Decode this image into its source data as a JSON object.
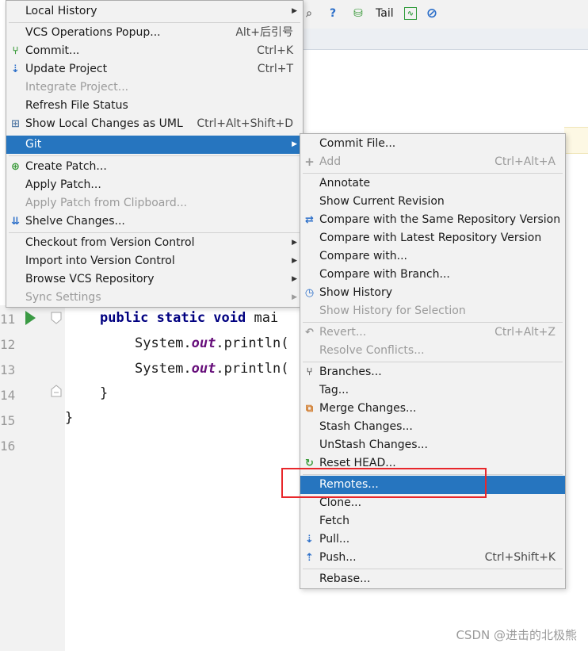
{
  "toolbar": {
    "help_icon": "question-icon",
    "tail_label": "Tail"
  },
  "editor": {
    "line_numbers": [
      "11",
      "12",
      "13",
      "14",
      "15",
      "16"
    ],
    "lines": {
      "l11_kw": "public static void ",
      "l11_name": "mai",
      "l12_obj": "System.",
      "l12_field": "out",
      "l12_call": ".println(",
      "l13_obj": "System.",
      "l13_field": "out",
      "l13_call": ".println(",
      "l14": "}",
      "l15": "}"
    }
  },
  "vcs_menu": {
    "items": [
      {
        "label": "Local History",
        "submenu": true
      },
      {
        "label": "VCS Operations Popup...",
        "shortcut": "Alt+后引号"
      },
      {
        "label": "Commit...",
        "shortcut": "Ctrl+K",
        "icon": "commit-icon"
      },
      {
        "label": "Update Project",
        "shortcut": "Ctrl+T",
        "icon": "update-project-icon"
      },
      {
        "label": "Integrate Project...",
        "disabled": true
      },
      {
        "label": "Refresh File Status"
      },
      {
        "label": "Show Local Changes as UML",
        "shortcut": "Ctrl+Alt+Shift+D",
        "icon": "uml-icon"
      },
      {
        "label": "Git",
        "submenu": true,
        "selected": true
      },
      {
        "label": "Create Patch...",
        "icon": "create-patch-icon"
      },
      {
        "label": "Apply Patch..."
      },
      {
        "label": "Apply Patch from Clipboard...",
        "disabled": true
      },
      {
        "label": "Shelve Changes...",
        "icon": "shelve-icon"
      },
      {
        "label": "Checkout from Version Control",
        "submenu": true
      },
      {
        "label": "Import into Version Control",
        "submenu": true
      },
      {
        "label": "Browse VCS Repository",
        "submenu": true
      },
      {
        "label": "Sync Settings",
        "submenu": true,
        "disabled": true
      }
    ]
  },
  "git_menu": {
    "items": [
      {
        "label": "Commit File..."
      },
      {
        "label": "Add",
        "shortcut": "Ctrl+Alt+A",
        "disabled": true,
        "icon": "plus-icon"
      },
      {
        "label": "Annotate"
      },
      {
        "label": "Show Current Revision"
      },
      {
        "label": "Compare with the Same Repository Version",
        "icon": "compare-icon"
      },
      {
        "label": "Compare with Latest Repository Version"
      },
      {
        "label": "Compare with..."
      },
      {
        "label": "Compare with Branch..."
      },
      {
        "label": "Show History",
        "icon": "history-icon"
      },
      {
        "label": "Show History for Selection",
        "disabled": true
      },
      {
        "label": "Revert...",
        "shortcut": "Ctrl+Alt+Z",
        "disabled": true,
        "icon": "revert-icon"
      },
      {
        "label": "Resolve Conflicts...",
        "disabled": true
      },
      {
        "label": "Branches...",
        "icon": "branches-icon"
      },
      {
        "label": "Tag..."
      },
      {
        "label": "Merge Changes...",
        "icon": "merge-icon"
      },
      {
        "label": "Stash Changes..."
      },
      {
        "label": "UnStash Changes..."
      },
      {
        "label": "Reset HEAD...",
        "icon": "reset-head-icon"
      },
      {
        "label": "Remotes...",
        "selected": true
      },
      {
        "label": "Clone..."
      },
      {
        "label": "Fetch"
      },
      {
        "label": "Pull...",
        "icon": "pull-icon"
      },
      {
        "label": "Push...",
        "shortcut": "Ctrl+Shift+K",
        "icon": "push-icon"
      },
      {
        "label": "Rebase..."
      }
    ]
  },
  "colors": {
    "selection": "#2675bf",
    "highlight_box": "#e8272b"
  },
  "watermark": "CSDN @进击的北极熊"
}
